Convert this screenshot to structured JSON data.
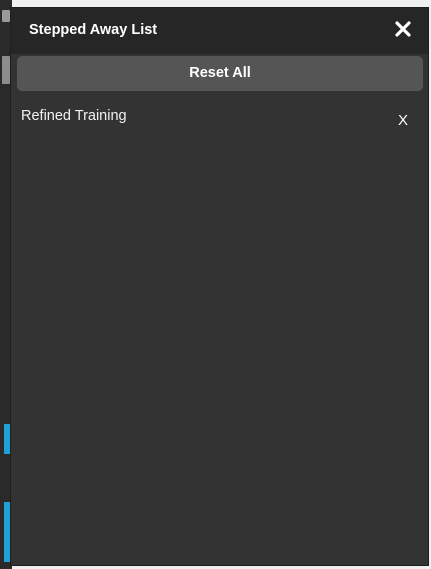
{
  "dialog": {
    "title": "Stepped Away List",
    "close_icon": "close-icon",
    "reset_label": "Reset All"
  },
  "list": {
    "items": [
      {
        "label": "Refined Training",
        "remove_label": "X"
      }
    ]
  },
  "colors": {
    "panel_bg": "#333333",
    "header_bg": "#262626",
    "button_bg": "#555555",
    "text": "#ffffff",
    "accent": "#1da1d8"
  }
}
